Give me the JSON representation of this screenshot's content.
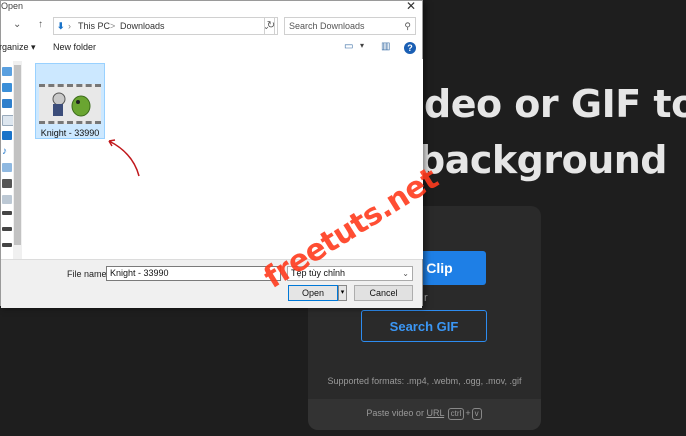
{
  "page": {
    "headline_line1": "deo or GIF to",
    "headline_line2": "background",
    "upload_button": "ad Clip",
    "or_text": "r",
    "search_gif_button": "Search GIF",
    "supported_formats": "Supported formats: .mp4, .webm, .ogg, .mov, .gif",
    "paste_prefix": "Paste video or",
    "paste_url": "URL",
    "paste_key1": "ctrl",
    "paste_plus": "+",
    "paste_key2": "v",
    "accent_color": "#1e7fe6"
  },
  "dialog": {
    "title": "Open",
    "address": {
      "pc": "This PC",
      "sep": ">",
      "folder": "Downloads"
    },
    "search_placeholder": "Search Downloads",
    "toolbar": {
      "organize": "rganize ▾",
      "new_folder": "New folder"
    },
    "files": [
      {
        "name": "Knight - 33990",
        "icon": "video-file-icon"
      }
    ],
    "file_name_label": "File name:",
    "file_name_value": "Knight - 33990",
    "file_type_value": "Tệp tùy chỉnh",
    "open_label": "Open",
    "cancel_label": "Cancel"
  },
  "watermark": "freetuts.net"
}
